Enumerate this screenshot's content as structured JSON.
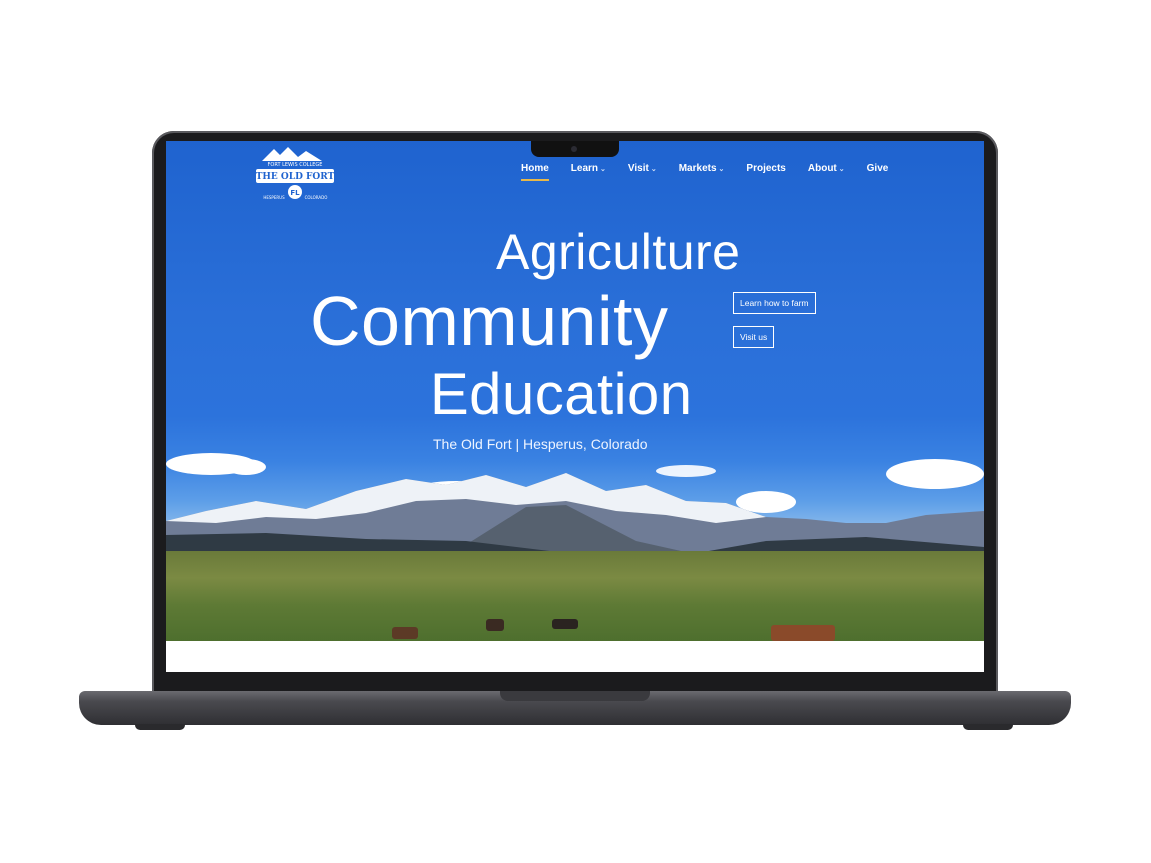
{
  "nav": {
    "items": [
      {
        "label": "Home",
        "active": true,
        "dropdown": false
      },
      {
        "label": "Learn",
        "active": false,
        "dropdown": true
      },
      {
        "label": "Visit",
        "active": false,
        "dropdown": true
      },
      {
        "label": "Markets",
        "active": false,
        "dropdown": true
      },
      {
        "label": "Projects",
        "active": false,
        "dropdown": false
      },
      {
        "label": "About",
        "active": false,
        "dropdown": true
      },
      {
        "label": "Give",
        "active": false,
        "dropdown": false
      }
    ],
    "dropdown_glyph": "⌄"
  },
  "logo": {
    "top_text": "FORT LEWIS COLLEGE",
    "banner_text": "THE OLD FORT",
    "left_text": "HESPERUS",
    "right_text": "COLORADO",
    "monogram": "FL"
  },
  "hero": {
    "line1": "Agriculture",
    "line2": "Community",
    "line3": "Education",
    "tagline": "The Old Fort | Hesperus, Colorado"
  },
  "cta": {
    "learn_label": "Learn how to farm",
    "visit_label": "Visit us"
  },
  "colors": {
    "sky": "#1f63cf",
    "nav_active_underline": "#e8b84a",
    "text": "#ffffff"
  }
}
